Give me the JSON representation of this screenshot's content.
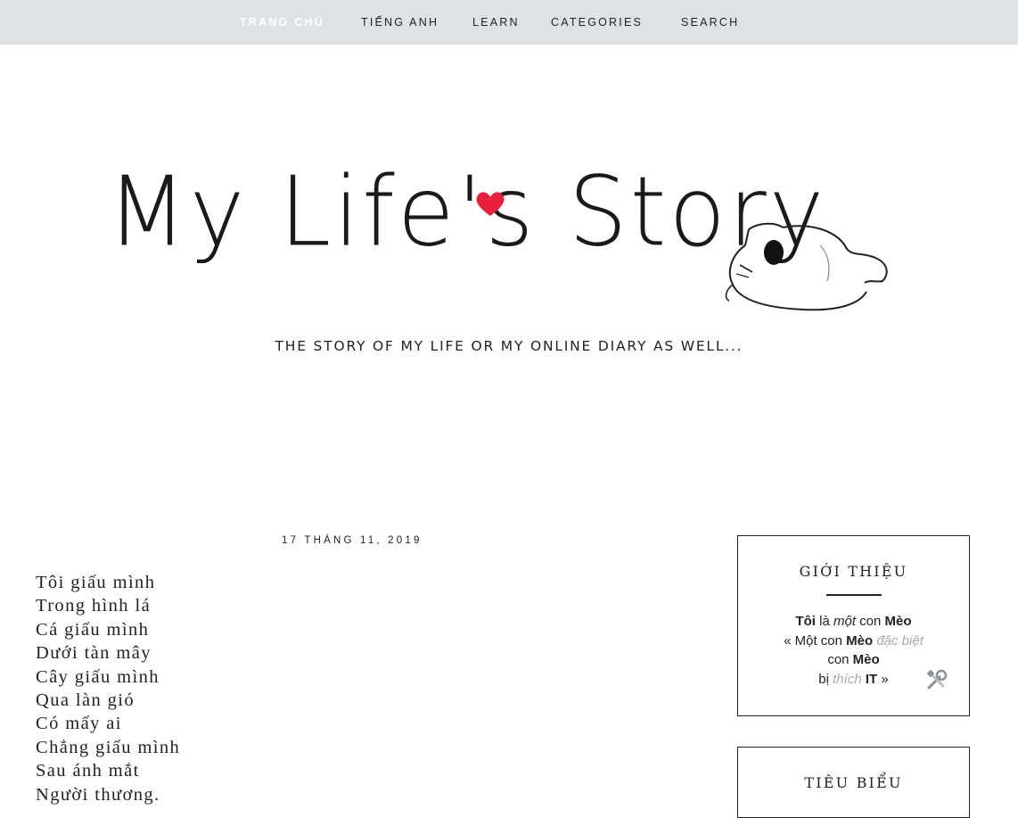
{
  "nav": {
    "items": [
      {
        "label": "TRANG CHỦ",
        "active": true
      },
      {
        "label": "TIẾNG ANH"
      },
      {
        "label": "LEARN"
      },
      {
        "label": "CATEGORIES"
      },
      {
        "label": "SEARCH"
      }
    ]
  },
  "header": {
    "logo_text": "My Life's Story",
    "tagline": "THE STORY OF MY LIFE OR MY ONLINE DIARY AS WELL..."
  },
  "post": {
    "date": "17 THÁNG 11, 2019",
    "poem_lines": [
      "Tôi giấu mình",
      "Trong hình lá",
      "Cá giấu mình",
      "Dưới tàn mây",
      "Cây giấu mình",
      "Qua làn gió",
      "Có mấy ai",
      "Chẳng giấu mình",
      "Sau ánh mắt",
      "Người thương."
    ]
  },
  "sidebar": {
    "about": {
      "title": "GIỚI THIỆU",
      "line1": {
        "w1": "Tôi",
        "w2": " là ",
        "w3": "một",
        "w4": " con ",
        "w5": "Mèo"
      },
      "line2": {
        "w1": "« Một con ",
        "w2": "Mèo",
        "w3": " đặc biệt"
      },
      "line3": {
        "w1": "con ",
        "w2": "Mèo"
      },
      "line4": {
        "w1": "bị ",
        "w2": "thích",
        "w3": " IT",
        "w4": " »"
      }
    },
    "featured": {
      "title": "TIÊU BIỂU"
    }
  },
  "colors": {
    "nav_bg": "#dee1e6",
    "heart": "#e8203c",
    "muted_text": "#aaaaaa"
  },
  "icons": [
    "heart-icon",
    "cat-drawing",
    "tools-icon"
  ]
}
